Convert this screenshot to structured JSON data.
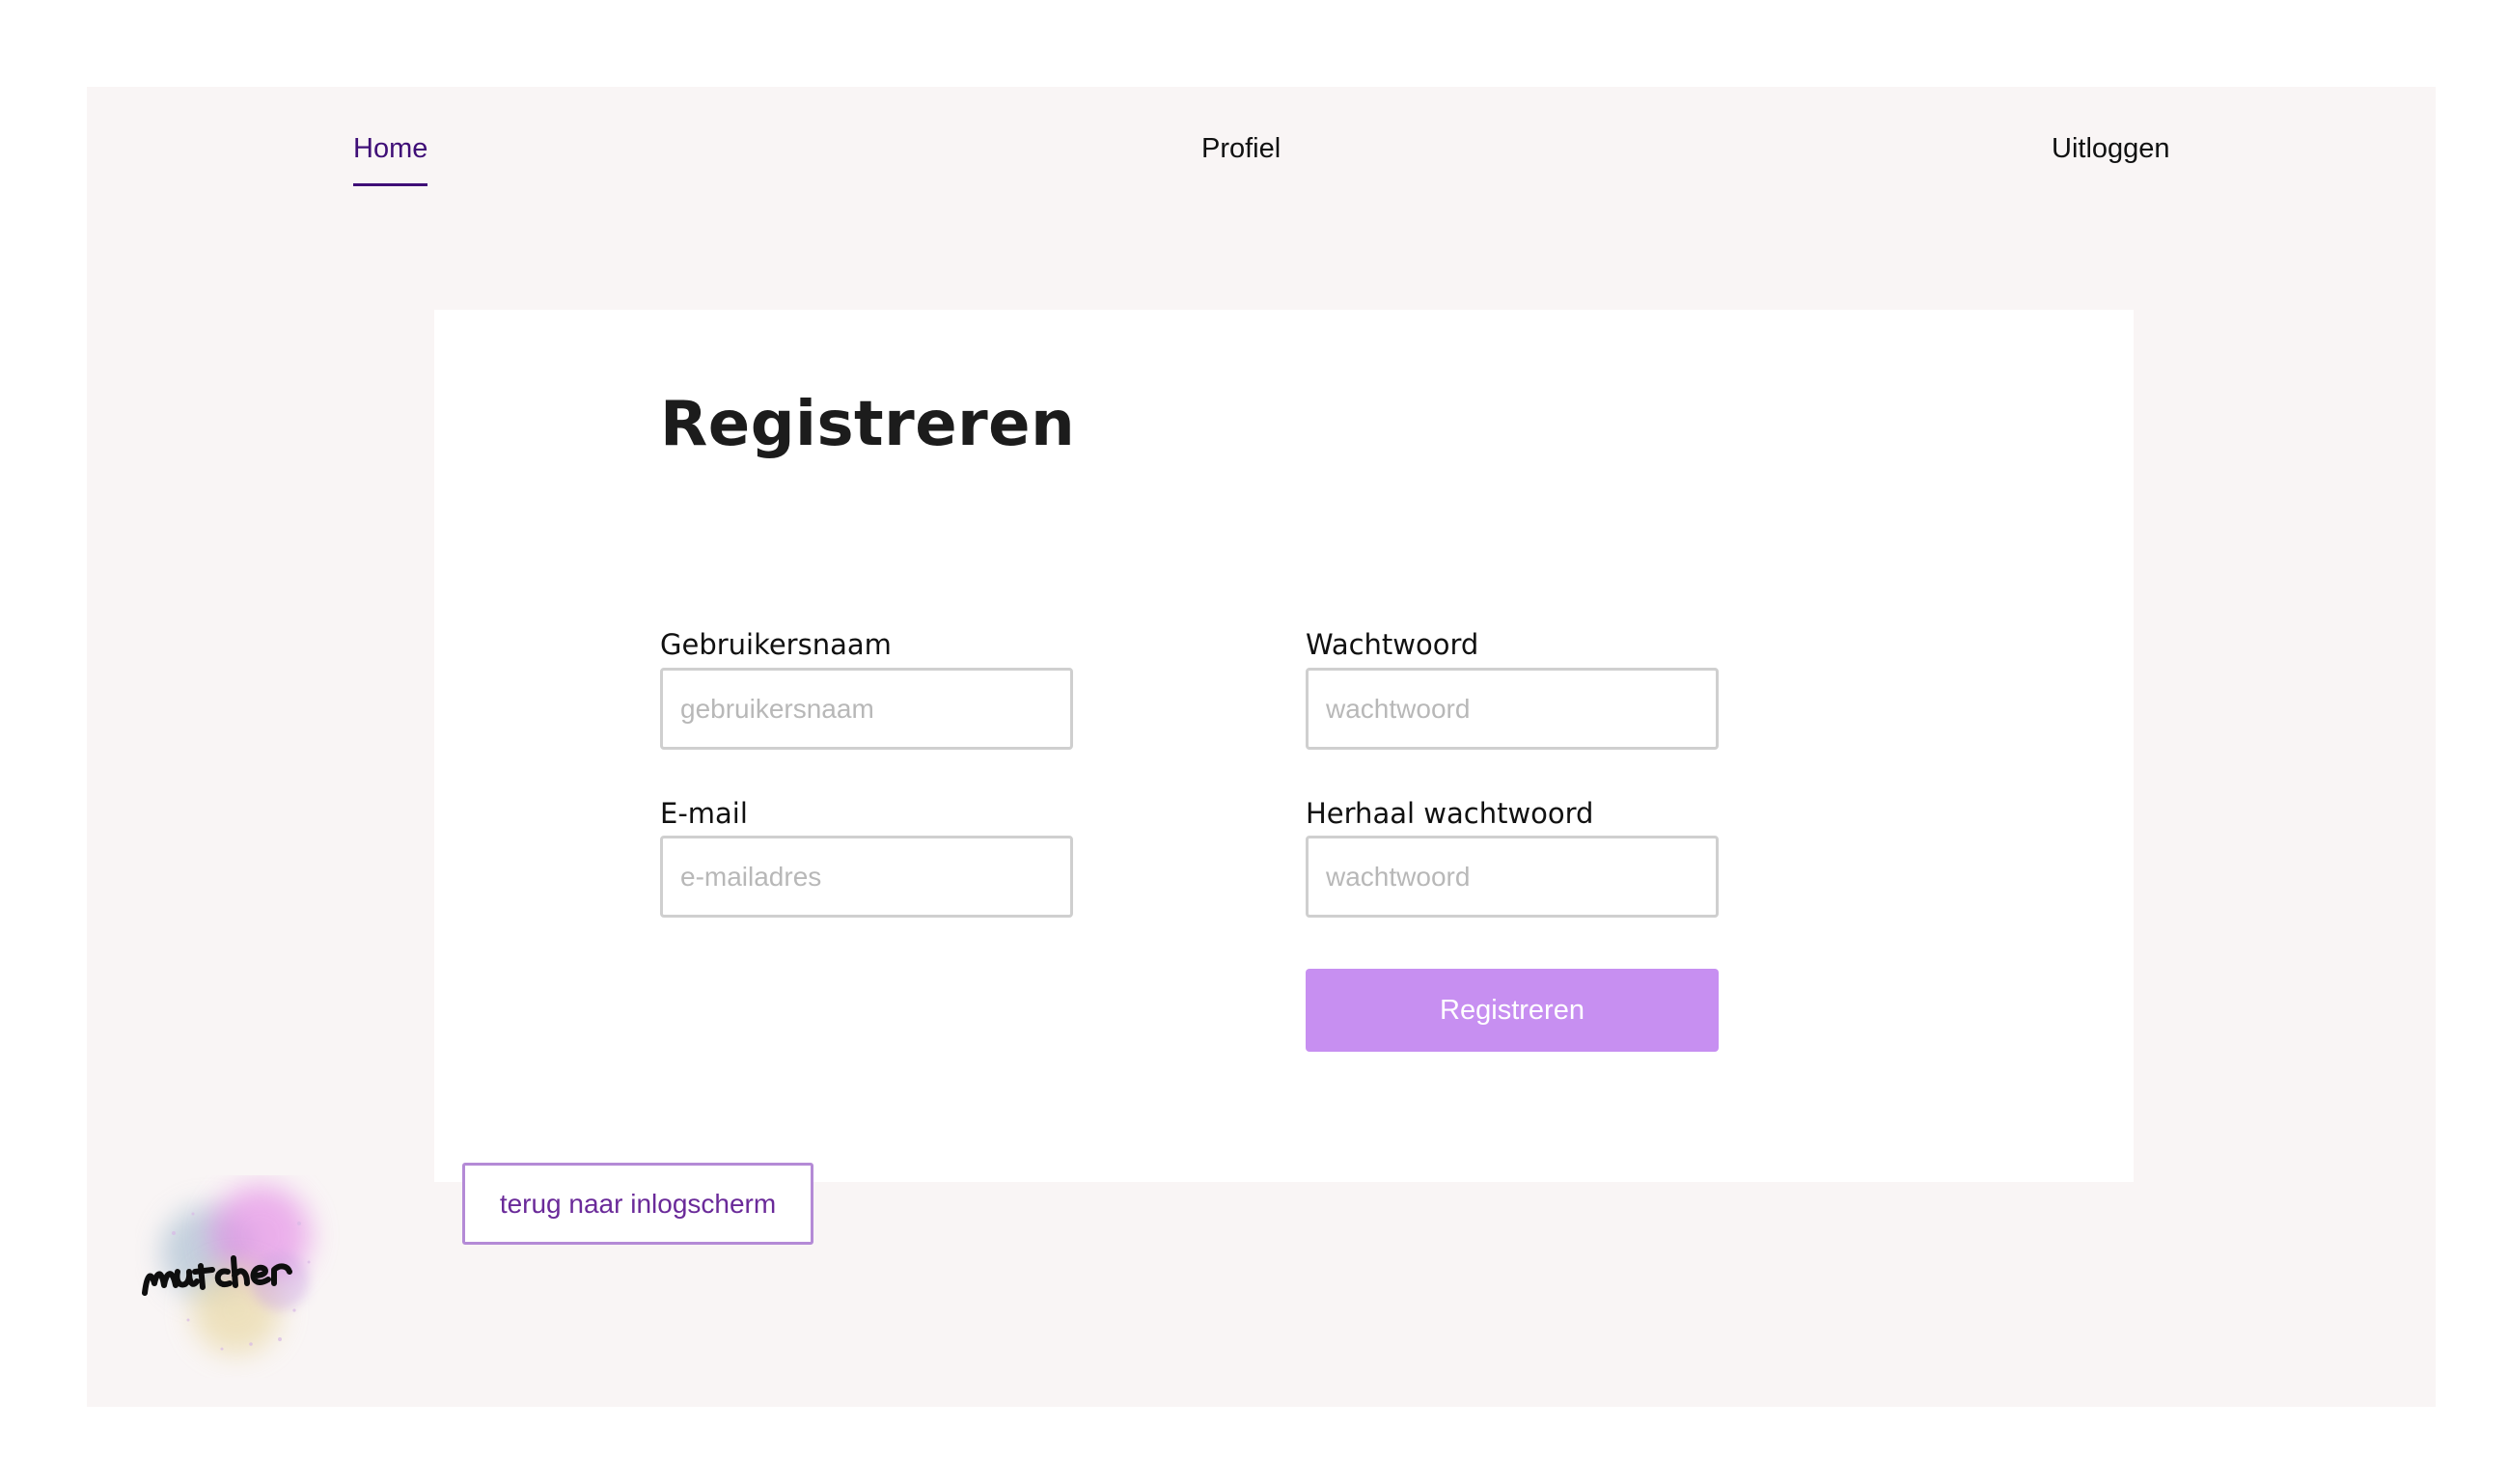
{
  "nav": {
    "items": [
      {
        "label": "Home",
        "active": true
      },
      {
        "label": "Profiel",
        "active": false
      },
      {
        "label": "Uitloggen",
        "active": false
      }
    ]
  },
  "form": {
    "title": "Registreren",
    "username": {
      "label": "Gebruikersnaam",
      "placeholder": "gebruikersnaam",
      "value": ""
    },
    "email": {
      "label": "E-mail",
      "placeholder": "e-mailadres",
      "value": ""
    },
    "password": {
      "label": "Wachtwoord",
      "placeholder": "wachtwoord",
      "value": ""
    },
    "repeat_password": {
      "label": "Herhaal wachtwoord",
      "placeholder": "wachtwoord",
      "value": ""
    },
    "submit_label": "Registreren",
    "back_label": "terug naar inlogscherm"
  },
  "logo": {
    "icon": "matcher-logo-icon",
    "text": "Matcher"
  },
  "colors": {
    "accent": "#3f0e77",
    "button": "#c78ff1",
    "back_text": "#6a2a99",
    "frame_bg": "#f9f5f5"
  }
}
